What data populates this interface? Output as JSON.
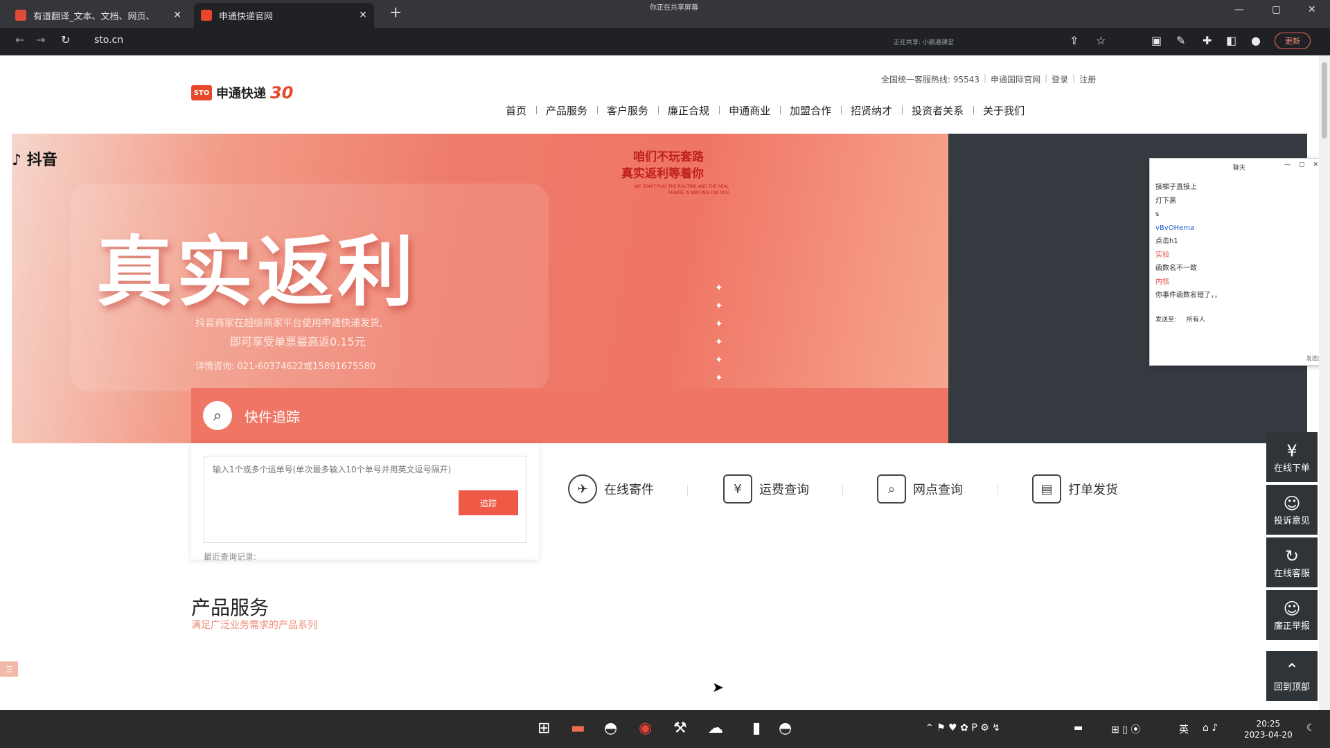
{
  "browser": {
    "tabs": [
      {
        "title": "有道翻译_文本、文档、网页、",
        "close": "✕"
      },
      {
        "title": "申通快递官网",
        "close": "✕"
      }
    ],
    "new_tab": "+",
    "share_title": "你正在共享屏幕",
    "url": "sto.cn",
    "sharing_notice": "正在共享: 小鹅通课堂",
    "update_label": "更新",
    "back": "←",
    "forward": "→",
    "reload": "↻"
  },
  "site": {
    "top_links": [
      "全国统一客服热线: 95543",
      "申通国际官网",
      "登录",
      "注册"
    ],
    "logo_badge": "STO",
    "logo_name": "申通快递",
    "logo_anniversary": "30",
    "nav": [
      "首页",
      "产品服务",
      "客户服务",
      "廉正合规",
      "申通商业",
      "加盟合作",
      "招贤纳才",
      "投资者关系",
      "关于我们"
    ]
  },
  "banner": {
    "platform": "抖音",
    "headline": "真实返利",
    "slogan_line1": "咱们不玩套路",
    "slogan_line2": "真实返利等着你",
    "slogan_en": "WE DON'T PLAY THE ROUTINE AND THE REAL REBATE IS WAITING FOR YOU",
    "desc_line1": "抖音商家在超级商家平台使用申通快递发货,",
    "desc_line2": "即可享受单票最高返0.15元",
    "desc_line3": "详情咨询: 021-60374622或15891675580"
  },
  "tracking": {
    "title": "快件追踪",
    "placeholder": "输入1个或多个运单号(单次最多输入10个单号并用英文逗号隔开)",
    "button": "追踪",
    "recent_label": "最近查询记录:"
  },
  "quick_links": [
    {
      "label": "在线寄件",
      "icon": "✈"
    },
    {
      "label": "运费查询",
      "icon": "¥"
    },
    {
      "label": "网点查询",
      "icon": "⌕"
    },
    {
      "label": "打单发货",
      "icon": "▤"
    }
  ],
  "products": {
    "title": "产品服务",
    "subtitle": "满足广泛业务需求的产品系列"
  },
  "float_nav": [
    {
      "label": "在线下单",
      "icon": "¥"
    },
    {
      "label": "投诉意见",
      "icon": "☺"
    },
    {
      "label": "在线客服",
      "icon": "↻"
    },
    {
      "label": "廉正举报",
      "icon": "☺"
    },
    {
      "label": "回到顶部",
      "icon": "⌃"
    }
  ],
  "chat": {
    "title": "聊天",
    "messages": [
      {
        "text": "接梯子直接上",
        "color": "n"
      },
      {
        "text": "灯下黑",
        "color": "n"
      },
      {
        "text": "s",
        "color": "n"
      },
      {
        "text": "vBvOHema",
        "color": "b"
      },
      {
        "text": "点击h1",
        "color": "n"
      },
      {
        "text": "实验",
        "color": "r"
      },
      {
        "text": "函数名不一致",
        "color": "n"
      },
      {
        "text": "内核",
        "color": "r"
      },
      {
        "text": "你事件函数名错了，，",
        "color": "n"
      }
    ],
    "send_to_label": "发送至:",
    "send_to_value": "所有人",
    "bottom_label": "发送(S)"
  },
  "sidebar_tab": "三",
  "taskbar": {
    "time": "20:25",
    "date": "2023-04-20",
    "lang": "英"
  }
}
